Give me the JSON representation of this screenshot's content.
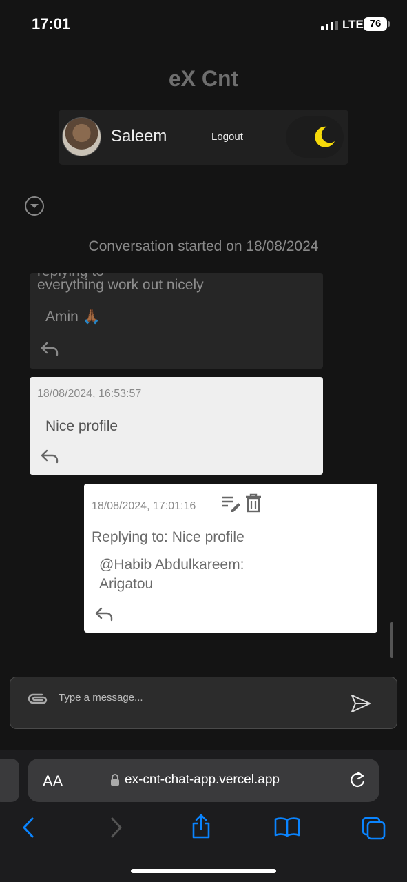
{
  "status_bar": {
    "time": "17:01",
    "network": "LTE",
    "battery": "76"
  },
  "app": {
    "title": "eX Cnt"
  },
  "user": {
    "name": "Saleem",
    "logout_label": "Logout"
  },
  "conversation": {
    "started_label": "Conversation started on 18/08/2024",
    "messages": [
      {
        "cut_text": "replying to",
        "text_line": "everything work out nicely",
        "reply_text": "Amin 🙏🏾"
      },
      {
        "timestamp": "18/08/2024, 16:53:57",
        "text": "Nice profile"
      },
      {
        "timestamp": "18/08/2024, 17:01:16",
        "replying_to": "Replying to: Nice profile",
        "text_line1": "@Habib Abdulkareem:",
        "text_line2": "Arigatou"
      }
    ]
  },
  "composer": {
    "placeholder": "Type a message..."
  },
  "browser": {
    "text_size_label": "AA",
    "url": "ex-cnt-chat-app.vercel.app"
  },
  "colors": {
    "background": "#141414",
    "accent": "#0a84ff",
    "moon": "#f5d90a"
  }
}
